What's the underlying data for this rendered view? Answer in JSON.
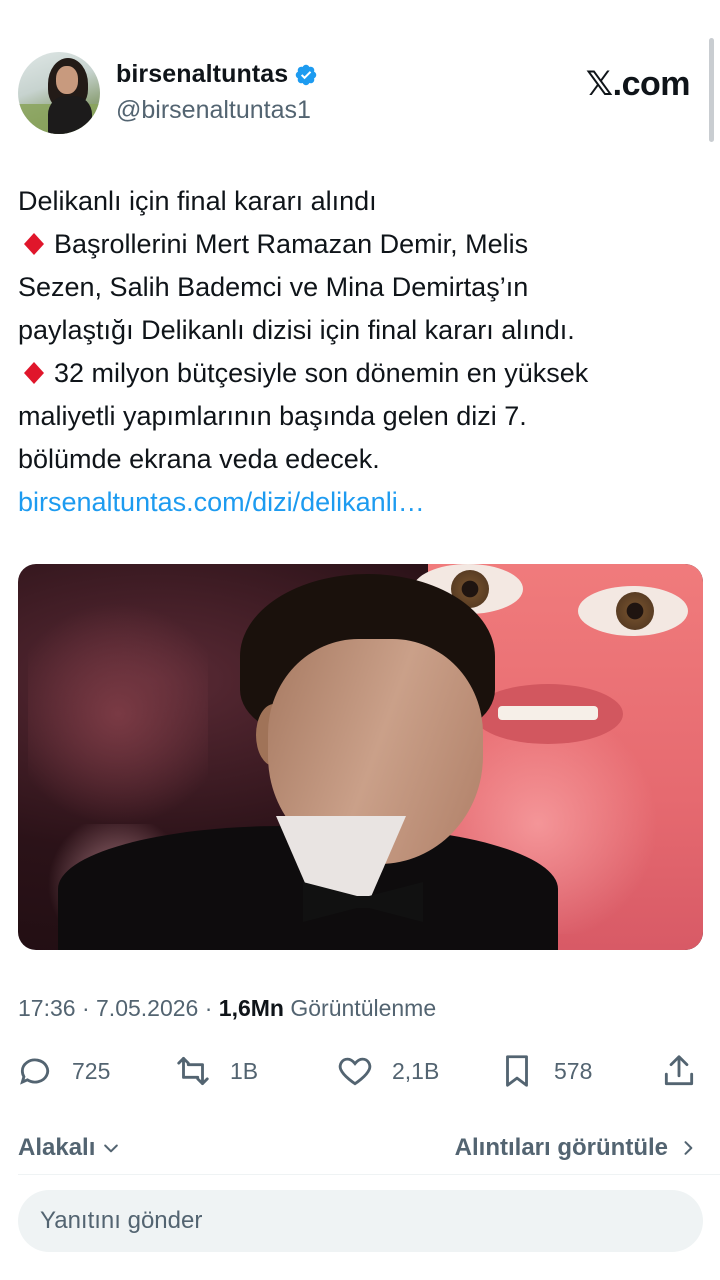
{
  "author": {
    "display_name": "birsenaltuntas",
    "handle": "@birsenaltuntas1",
    "verified": true,
    "avatar_icon": "profile-photo"
  },
  "brand": {
    "label": "𝕏.com"
  },
  "tweet": {
    "lines": [
      "Delikanlı için final kararı alındı",
      "Başrollerini Mert Ramazan Demir, Melis",
      "Sezen, Salih Bademci ve Mina Demirtaş’ın",
      "paylaştığı Delikanlı dizisi için final kararı alındı.",
      "32 milyon bütçesiyle son dönemin en yüksek",
      "maliyetli yapımlarının başında gelen dizi 7.",
      "bölümde ekrana veda edecek."
    ],
    "link": "birsenaltuntas.com/dizi/delikanli…",
    "bullet_icon": "red-diamond-emoji"
  },
  "meta": {
    "time": "17:36",
    "separator": " · ",
    "date": "7.05.2026",
    "separator2": " · ",
    "views_count": "1,6Mn",
    "views_label": " Görüntülenme"
  },
  "actions": {
    "replies": "725",
    "reposts": "1B",
    "likes": "2,1B",
    "bookmarks": "578"
  },
  "sort": {
    "label": "Alakalı"
  },
  "quotes": {
    "label": "Alıntıları görüntüle"
  },
  "reply_box": {
    "placeholder": "Yanıtını gönder"
  },
  "colors": {
    "link": "#1d9bf0",
    "secondary_text": "#536471",
    "primary_text": "#0f1419",
    "verified": "#1d9bf0",
    "diamond": "#e0162b"
  }
}
